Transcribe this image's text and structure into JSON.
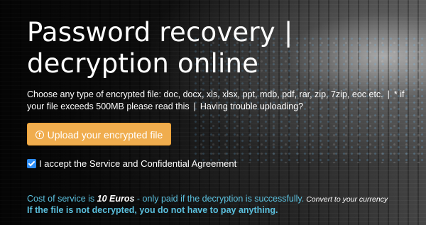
{
  "hero": {
    "title": "Password recovery | decryption online",
    "intro_text": "Choose any type of encrypted file: doc, docx, xls, xlsx, ppt, mdb, pdf, rar, zip, 7zip, eoc etc.",
    "separator": "|",
    "large_file_link": "* if your file exceeds 500MB please read this",
    "trouble_link": "Having trouble uploading?"
  },
  "upload": {
    "button_label": "Upload your encrypted file",
    "icon": "upload-circle-icon"
  },
  "agreement": {
    "checked": true,
    "label": "I accept the Service and Confidential Agreement"
  },
  "cost": {
    "prefix": "Cost of service is ",
    "price": "10 Euros",
    "suffix": " - only paid if the decryption is successfully.",
    "convert_link": "Convert to your currency",
    "guarantee": "If the file is not decrypted, you do not have to pay anything."
  },
  "colors": {
    "button": "#f0ad4e",
    "accent_blue": "#5bc0de",
    "checkbox": "#2c8cf4"
  }
}
